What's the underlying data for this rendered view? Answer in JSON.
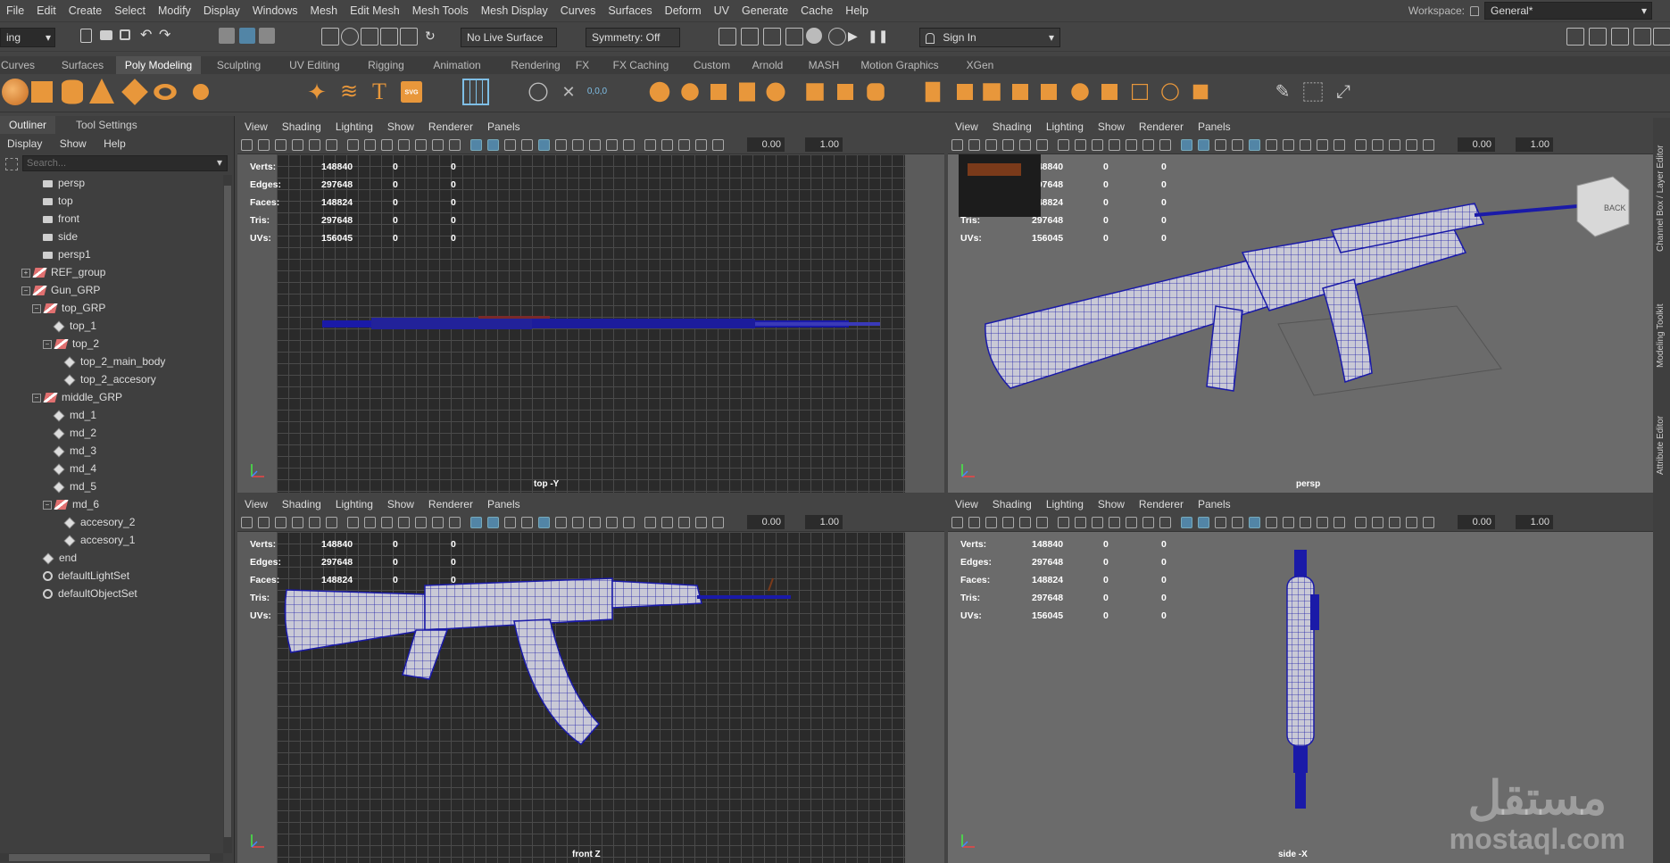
{
  "menubar": {
    "items": [
      "File",
      "Edit",
      "Create",
      "Select",
      "Modify",
      "Display",
      "Windows",
      "Mesh",
      "Edit Mesh",
      "Mesh Tools",
      "Mesh Display",
      "Curves",
      "Surfaces",
      "Deform",
      "UV",
      "Generate",
      "Cache",
      "Help"
    ],
    "workspace_label": "Workspace:",
    "workspace_value": "General*"
  },
  "statusline": {
    "mode": "ing",
    "live_surface": "No Live Surface",
    "symmetry": "Symmetry: Off",
    "sign_in": "Sign In"
  },
  "shelf": {
    "tabs": [
      "Curves",
      "Surfaces",
      "Poly Modeling",
      "Sculpting",
      "UV Editing",
      "Rigging",
      "Animation",
      "Rendering",
      "FX",
      "FX Caching",
      "Custom",
      "Arnold",
      "MASH",
      "Motion Graphics",
      "XGen"
    ],
    "active_tab": "Poly Modeling",
    "svg_label": "SVG",
    "type_label": "T",
    "xyz_label": "0,0,0"
  },
  "outliner": {
    "tabs": [
      "Outliner",
      "Tool Settings"
    ],
    "menu": [
      "Display",
      "Show",
      "Help"
    ],
    "search_placeholder": "Search...",
    "items": [
      {
        "label": "persp",
        "icon": "camera-icon"
      },
      {
        "label": "top",
        "icon": "camera-icon"
      },
      {
        "label": "front",
        "icon": "camera-icon"
      },
      {
        "label": "side",
        "icon": "camera-icon"
      },
      {
        "label": "persp1",
        "icon": "camera-icon"
      },
      {
        "label": "REF_group",
        "icon": "group-icon"
      },
      {
        "label": "Gun_GRP",
        "icon": "group-icon"
      },
      {
        "label": "top_GRP",
        "icon": "group-icon"
      },
      {
        "label": "top_1",
        "icon": "mesh-icon"
      },
      {
        "label": "top_2",
        "icon": "group-icon"
      },
      {
        "label": "top_2_main_body",
        "icon": "mesh-icon"
      },
      {
        "label": "top_2_accesory",
        "icon": "mesh-icon"
      },
      {
        "label": "middle_GRP",
        "icon": "group-icon"
      },
      {
        "label": "md_1",
        "icon": "mesh-icon"
      },
      {
        "label": "md_2",
        "icon": "mesh-icon"
      },
      {
        "label": "md_3",
        "icon": "mesh-icon"
      },
      {
        "label": "md_4",
        "icon": "mesh-icon"
      },
      {
        "label": "md_5",
        "icon": "mesh-icon"
      },
      {
        "label": "md_6",
        "icon": "group-icon"
      },
      {
        "label": "accesory_2",
        "icon": "mesh-icon"
      },
      {
        "label": "accesory_1",
        "icon": "mesh-icon"
      },
      {
        "label": "end",
        "icon": "mesh-icon"
      },
      {
        "label": "defaultLightSet",
        "icon": "set-icon"
      },
      {
        "label": "defaultObjectSet",
        "icon": "set-icon"
      }
    ]
  },
  "viewport_menu": [
    "View",
    "Shading",
    "Lighting",
    "Show",
    "Renderer",
    "Panels"
  ],
  "viewport_fields": {
    "exposure": "0.00",
    "gamma": "1.00"
  },
  "hud": {
    "rows": [
      {
        "label": "Verts:",
        "v1": "148840",
        "v2": "0",
        "v3": "0"
      },
      {
        "label": "Edges:",
        "v1": "297648",
        "v2": "0",
        "v3": "0"
      },
      {
        "label": "Faces:",
        "v1": "148824",
        "v2": "0",
        "v3": "0"
      },
      {
        "label": "Tris:",
        "v1": "297648",
        "v2": "0",
        "v3": "0"
      },
      {
        "label": "UVs:",
        "v1": "156045",
        "v2": "0",
        "v3": "0"
      }
    ]
  },
  "viewports": {
    "top": {
      "label": "top -Y"
    },
    "persp": {
      "label": "persp",
      "viewcube": "BACK"
    },
    "front": {
      "label": "front Z"
    },
    "side": {
      "label": "side -X"
    }
  },
  "right_panels": [
    "Channel Box / Layer Editor",
    "Modeling Toolkit",
    "Attribute Editor"
  ],
  "watermark": {
    "arabic": "مستقل",
    "latin": "mostaql.com"
  },
  "colors": {
    "wire": "#1a1aa8",
    "mesh": "#c8c8d8",
    "accent": "#5285a6"
  }
}
